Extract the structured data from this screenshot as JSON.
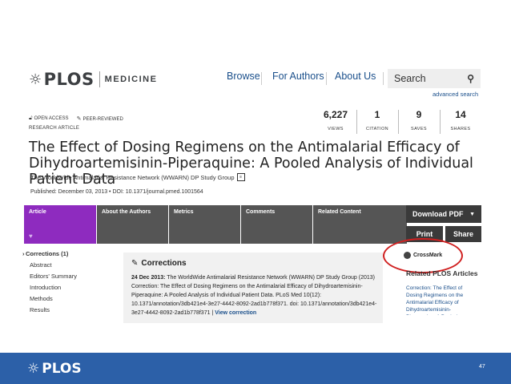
{
  "brand": {
    "logo_text": "PLOS",
    "journal": "MEDICINE"
  },
  "nav": {
    "items": [
      "Browse",
      "For Authors",
      "About Us"
    ],
    "search_placeholder": "Search",
    "advanced_search": "advanced search"
  },
  "badges": {
    "open_access": "OPEN ACCESS",
    "peer_reviewed": "PEER-REVIEWED"
  },
  "article_type": "RESEARCH ARTICLE",
  "metrics": [
    {
      "value": "6,227",
      "label": "VIEWS"
    },
    {
      "value": "1",
      "label": "CITATION"
    },
    {
      "value": "9",
      "label": "SAVES"
    },
    {
      "value": "14",
      "label": "SHARES"
    }
  ],
  "article": {
    "title_line1": "The Effect of Dosing Regimens on the Antimalarial Efficacy of",
    "title_line2": "Dihydroartemisinin-Piperaquine: A Pooled Analysis of Individual Patient Data",
    "authors": "The WorldWide Antimalarial Resistance Network (WWARN) DP Study Group",
    "published": "Published: December 03, 2013 • DOI: 10.1371/journal.pmed.1001564"
  },
  "tabs": [
    {
      "label": "Article",
      "color": "#8e2bbf"
    },
    {
      "label": "About the Authors",
      "color": "#555555"
    },
    {
      "label": "Metrics",
      "color": "#555555"
    },
    {
      "label": "Comments",
      "color": "#555555"
    },
    {
      "label": "Related Content",
      "color": "#555555"
    }
  ],
  "actions": {
    "download": "Download PDF",
    "print": "Print",
    "share": "Share"
  },
  "left_nav": [
    "Corrections (1)",
    "Abstract",
    "Editors' Summary",
    "Introduction",
    "Methods",
    "Results"
  ],
  "corrections": {
    "heading": "Corrections",
    "date": "24 Dec 2013:",
    "body": "The WorldWide Antimalarial Resistance Network (WWARN) DP Study Group (2013) Correction: The Effect of Dosing Regimens on the Antimalarial Efficacy of Dihydroartemisinin-Piperaquine: A Pooled Analysis of Individual Patient Data. PLoS Med 10(12): 10.1371/annotation/3db421e4-3e27-4442-8092-2ad1b778f371. doi: 10.1371/annotation/3db421e4-3e27-4442-8092-2ad1b778f371 |",
    "link": "View correction"
  },
  "crossmark": "CrossMark",
  "related": {
    "heading": "Related PLOS Articles",
    "link": "Correction: The Effect of Dosing Regimens on the Antimalarial Efficacy of Dihydroartemisinin-Piperaquine: A Pooled"
  },
  "footer": {
    "logo_text": "PLOS",
    "page_number": "47"
  },
  "colors": {
    "accent_purple": "#8e2bbf",
    "footer_blue": "#2c60a8",
    "highlight_red": "#d02020",
    "link_blue": "#1a4f8b"
  }
}
